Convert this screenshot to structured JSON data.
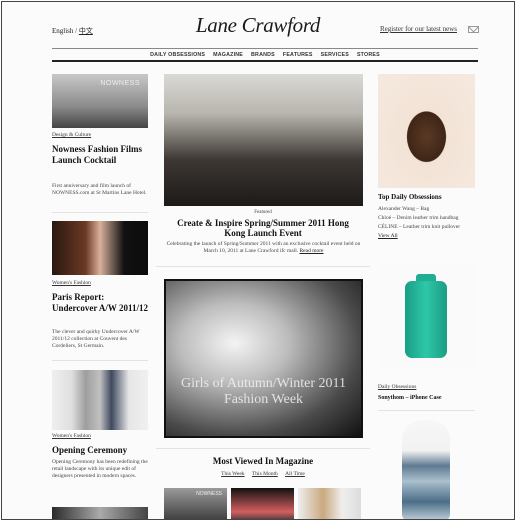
{
  "header": {
    "lang_english": "English",
    "lang_sep": "/",
    "lang_chinese": "中文",
    "logo": "Lane Crawford",
    "register": "Register for our latest news"
  },
  "nav": [
    "DAILY OBSESSIONS",
    "MAGAZINE",
    "BRANDS",
    "FEATURES",
    "SERVICES",
    "STORES"
  ],
  "left": {
    "a1": {
      "photo_text": "NOWNESS",
      "section": "Design & Culture",
      "title": "Nowness Fashion Films Launch Cocktail",
      "body": "First anniversary and film launch of NOWNESS.com at St Martins Lane Hotel."
    },
    "a2": {
      "section": "Women's Fashion",
      "title": "Paris Report: Undercover A/W 2011/12",
      "body": "The clever and quirky Undercover A/W 2011/12 collection at Couvent des Cordeliers, St Germain."
    },
    "a3": {
      "section": "Women's Fashion",
      "title": "Opening Ceremony",
      "body": "Opening Ceremony has been redefining the retail landscape with its unique edit of designers presented in modern spaces."
    }
  },
  "center": {
    "featured_label": "Featured",
    "featured_title": "Create & Inspire Spring/Summer 2011 Hong Kong Launch Event",
    "featured_body": "Celebrating the launch of Spring/Summer 2011 with an exclusive cocktail event held on March 10, 2011 at Lane Crawford ifc mall.",
    "read_more": "Read more",
    "overlay_text": "Girls of Autumn/Winter 2011 Fashion Week",
    "most_viewed_title": "Most Viewed In Magazine",
    "tabs": [
      "This Week",
      "This Month",
      "All Time"
    ],
    "mv_photo_text": "NOWNESS"
  },
  "right": {
    "title": "Top Daily Obsessions",
    "items": [
      "Alexander Wang – Bag",
      "Chloé – Denim leather trim handbag",
      "CÉLINE – Leather trim knit pullover"
    ],
    "view_all": "View All",
    "section2": "Daily Obsessions",
    "product2": "Sonythom – iPhone Case"
  }
}
